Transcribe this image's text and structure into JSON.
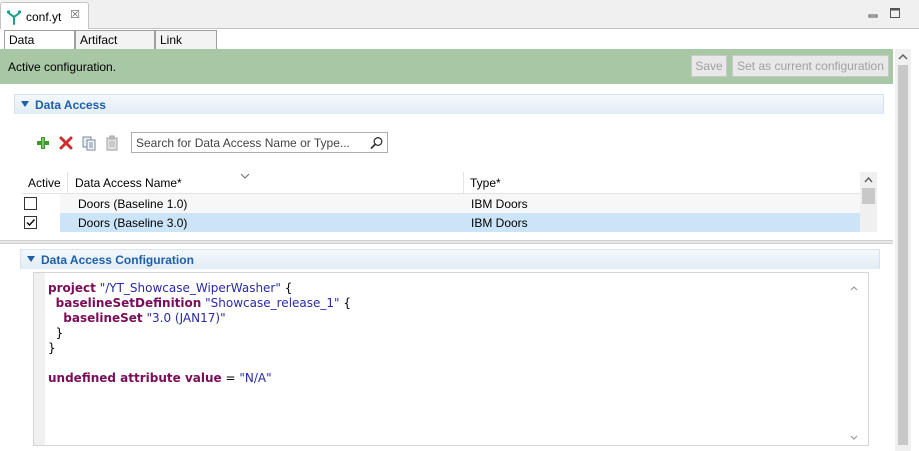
{
  "editor_tab": {
    "title": "conf.yt",
    "close": "☒"
  },
  "page_tabs": [
    "Data Access",
    "Artifact Types",
    "Link Types"
  ],
  "status": {
    "message": "Active configuration.",
    "save_label": "Save",
    "set_current_label": "Set as current configuration",
    "background_color": "#a8c7a4"
  },
  "data_access_section": {
    "title": "Data Access",
    "toolbar_icons": [
      "add-icon",
      "delete-icon",
      "copy-icon",
      "paste-icon"
    ],
    "search": {
      "placeholder": "Search for Data Access Name or Type...",
      "value": ""
    },
    "table": {
      "columns": [
        "Active",
        "Data Access Name*",
        "Type*"
      ],
      "rows": [
        {
          "active": false,
          "name": "Doors (Baseline 1.0)",
          "type": "IBM Doors"
        },
        {
          "active": true,
          "name": "Doors (Baseline 3.0)",
          "type": "IBM Doors",
          "selected": true
        }
      ]
    }
  },
  "config_section": {
    "title": "Data Access Configuration",
    "code": {
      "l1_kw": "project",
      "l1_str": "\"/YT_Showcase_WiperWasher\"",
      "l1_end": " {",
      "l2_kw": "baselineSetDefinition",
      "l2_str": "\"Showcase_release_1\"",
      "l2_end": " {",
      "l3_kw": "baselineSet",
      "l3_str": "\"3.0 (JAN17)\"",
      "l4": "}",
      "l5": "}",
      "l7_kw": "undefined attribute value",
      "l7_op": " = ",
      "l7_str": "\"N/A\""
    }
  },
  "colors": {
    "section_title": "#1e5fa8",
    "keyword": "#7a0c59",
    "string": "#2a2aa8",
    "selected_row": "#cce4f7"
  }
}
